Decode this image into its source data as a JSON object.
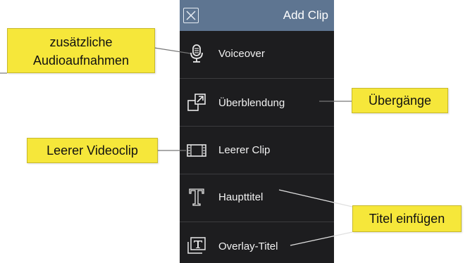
{
  "header": {
    "title": "Add Clip",
    "close_icon": "close-icon"
  },
  "menu": {
    "items": [
      {
        "label": "Voiceover",
        "icon": "microphone-icon"
      },
      {
        "label": "Überblendung",
        "icon": "transition-icon"
      },
      {
        "label": "Leerer Clip",
        "icon": "film-frame-icon"
      },
      {
        "label": "Haupttitel",
        "icon": "title-t-icon"
      },
      {
        "label": "Overlay-Titel",
        "icon": "overlay-title-icon"
      }
    ]
  },
  "callouts": {
    "audio_line1": "zusätzliche",
    "audio_line2": "Audioaufnahmen",
    "transitions": "Übergänge",
    "empty_clip": "Leerer Videoclip",
    "titles": "Titel einfügen"
  },
  "colors": {
    "panel_bg": "#1d1d1f",
    "header_bg": "#5e7591",
    "callout_bg": "#f6e73a"
  }
}
